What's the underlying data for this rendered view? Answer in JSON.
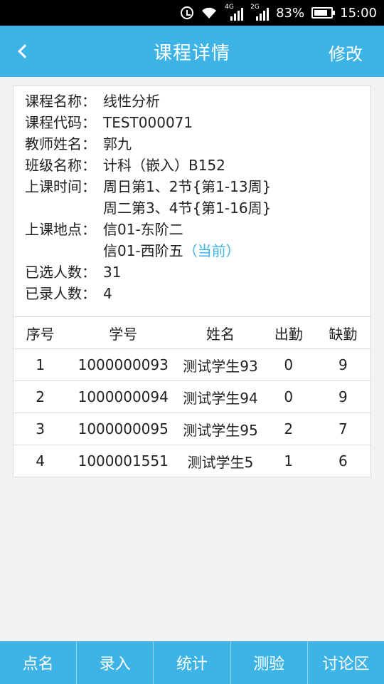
{
  "status_bar": {
    "net_tag_1": "4G",
    "net_tag_2": "2G",
    "battery_percent": "83%",
    "battery_level": 0.83,
    "time": "15:00",
    "icons": [
      "alarm-icon",
      "wifi-icon",
      "signal-icon",
      "battery-icon"
    ]
  },
  "header": {
    "title": "课程详情",
    "edit_label": "修改",
    "back_icon": "chevron-left-icon"
  },
  "course": {
    "name_label": "课程名称：",
    "name": "线性分析",
    "code_label": "课程代码：",
    "code": "TEST000071",
    "teacher_label": "教师姓名：",
    "teacher": "郭九",
    "class_label": "班级名称：",
    "class_name": "计科（嵌入）B152",
    "time_label": "上课时间：",
    "times": [
      "周日第1、2节{第1-13周}",
      "周二第3、4节{第1-16周}"
    ],
    "location_label": "上课地点：",
    "locations": [
      "信01-东阶二",
      "信01-西阶五"
    ],
    "current_tag": "（当前）",
    "selected_label": "已选人数：",
    "selected_count": "31",
    "recorded_label": "已录人数：",
    "recorded_count": "4"
  },
  "table": {
    "headers": [
      "序号",
      "学号",
      "姓名",
      "出勤",
      "缺勤"
    ],
    "rows": [
      [
        "1",
        "1000000093",
        "测试学生93",
        "0",
        "9"
      ],
      [
        "2",
        "1000000094",
        "测试学生94",
        "0",
        "9"
      ],
      [
        "3",
        "1000000095",
        "测试学生95",
        "2",
        "7"
      ],
      [
        "4",
        "1000001551",
        "测试学生5",
        "1",
        "6"
      ]
    ]
  },
  "bottom_nav": {
    "items": [
      "点名",
      "录入",
      "统计",
      "测验",
      "讨论区"
    ]
  },
  "colors": {
    "accent": "#3eb4e6",
    "background": "#f2f2f2",
    "status_bar": "#000000"
  }
}
